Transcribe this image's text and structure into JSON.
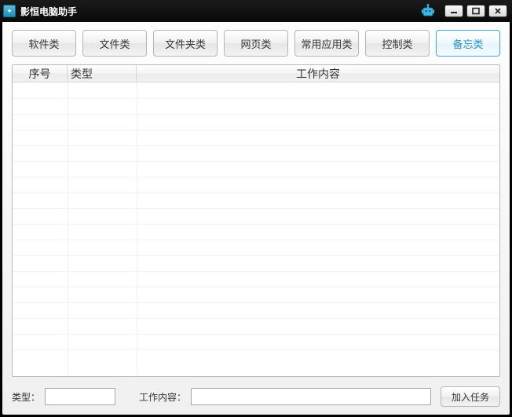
{
  "window": {
    "title": "影恒电脑助手"
  },
  "tabs": [
    {
      "label": "软件类",
      "active": false
    },
    {
      "label": "文件类",
      "active": false
    },
    {
      "label": "文件夹类",
      "active": false
    },
    {
      "label": "网页类",
      "active": false
    },
    {
      "label": "常用应用类",
      "active": false
    },
    {
      "label": "控制类",
      "active": false
    },
    {
      "label": "备忘类",
      "active": true
    }
  ],
  "table": {
    "columns": {
      "seq": "序号",
      "type": "类型",
      "content": "工作内容"
    },
    "rows": []
  },
  "footer": {
    "type_label": "类型：",
    "type_value": "",
    "content_label": "工作内容：",
    "content_value": "",
    "add_button": "加入任务"
  }
}
